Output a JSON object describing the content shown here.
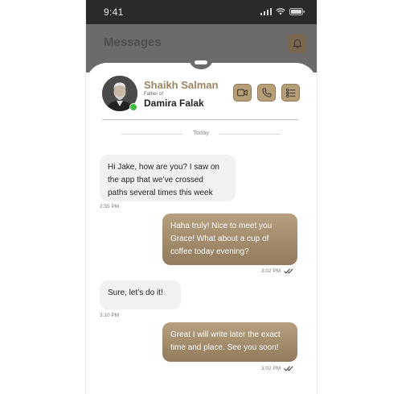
{
  "status_bar": {
    "time": "9:41"
  },
  "header": {
    "title": "Messages"
  },
  "contact": {
    "name": "Shaikh Salman",
    "relation_label": "Father of",
    "child_name": "Damira Falak",
    "online": true
  },
  "actions": [
    {
      "icon": "video-call-icon"
    },
    {
      "icon": "phone-call-icon"
    },
    {
      "icon": "list-icon"
    }
  ],
  "day_separator": "Today",
  "messages": [
    {
      "direction": "in",
      "text": "Hi Jake, how are you? I saw on\nthe app that we’ve crossed\npaths several times this week",
      "time": "2:55 PM"
    },
    {
      "direction": "out",
      "text": "Haha truly! Nice to meet you\nGrace! What about a cup of\ncoffee today evening?",
      "time": "3:02 PM",
      "read": true
    },
    {
      "direction": "in",
      "text": "Sure, let’s do it!",
      "time": "3:10 PM"
    },
    {
      "direction": "out",
      "text": "Great I will write later the exact\ntime and place. See you soon!",
      "time": "3:02 PM",
      "read": true
    }
  ],
  "colors": {
    "accent": "#9d8462",
    "accent_bubble_top": "#b6a080",
    "accent_bubble_bottom": "#927a5a",
    "incoming_bubble": "#f1f1f1",
    "online": "#3fbf3f"
  }
}
